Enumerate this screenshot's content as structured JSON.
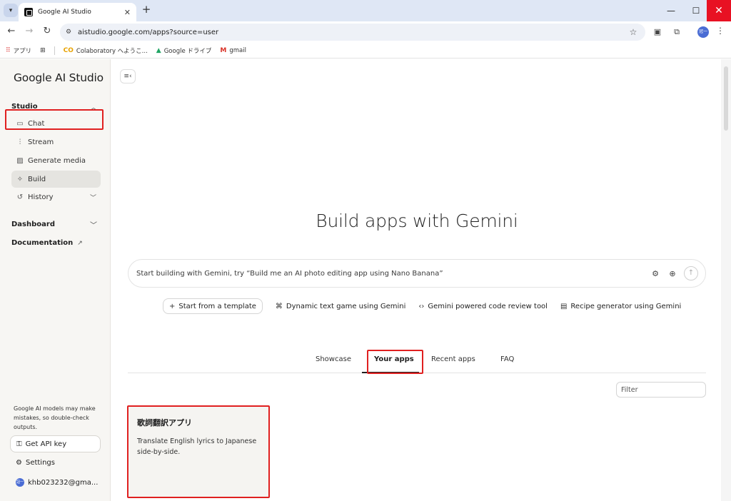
{
  "browser": {
    "tab_title": "Google AI Studio",
    "url": "aistudio.google.com/apps?source=user",
    "bookmarks": [
      {
        "label": "アプリ",
        "icon": "apps-grid-icon"
      },
      {
        "label": "Colaboratory へようこ...",
        "icon": "colab-icon"
      },
      {
        "label": "Google ドライブ",
        "icon": "drive-icon"
      },
      {
        "label": "gmail",
        "icon": "gmail-icon"
      }
    ],
    "profile_initials": "冠一"
  },
  "sidebar": {
    "logo": "Google AI Studio",
    "studio_section": "Studio",
    "items": [
      {
        "label": "Chat",
        "icon": "chat-icon"
      },
      {
        "label": "Stream",
        "icon": "stream-icon"
      },
      {
        "label": "Generate media",
        "icon": "media-icon"
      },
      {
        "label": "Build",
        "icon": "build-icon"
      },
      {
        "label": "History",
        "icon": "history-icon"
      }
    ],
    "dashboard": "Dashboard",
    "documentation": "Documentation",
    "disclaimer": "Google AI models may make mistakes, so double-check outputs.",
    "api_key_button": "Get API key",
    "settings": "Settings",
    "account_email": "khb023232@gma..."
  },
  "main": {
    "hero_title": "Build apps with Gemini",
    "prompt_placeholder": "Start building with Gemini, try “Build me an AI photo editing app using Nano Banana”",
    "template_button": "Start from a template",
    "suggestions": [
      {
        "label": "Dynamic text game using Gemini",
        "icon": "gamepad-icon"
      },
      {
        "label": "Gemini powered code review tool",
        "icon": "code-icon"
      },
      {
        "label": "Recipe generator using Gemini",
        "icon": "recipe-icon"
      }
    ],
    "tabs": [
      "Showcase",
      "Your apps",
      "Recent apps",
      "FAQ"
    ],
    "active_tab": "Your apps",
    "filter_placeholder": "Filter",
    "apps": [
      {
        "title": "歌詞翻訳アプリ",
        "description": "Translate English lyrics to Japanese side-by-side."
      }
    ]
  },
  "colors": {
    "highlight": "#e02020",
    "sidebar_bg": "#f7f6f3",
    "chrome_bg": "#dfe7f5"
  }
}
